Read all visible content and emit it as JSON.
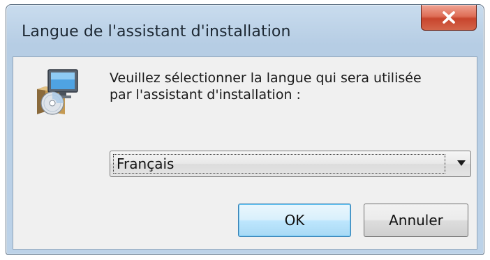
{
  "window": {
    "title": "Langue de l'assistant d'installation"
  },
  "titlebar": {
    "close_icon": "close-x-icon"
  },
  "content": {
    "icon": "setup-computer-disc-icon",
    "message_line1": "Veuillez sélectionner la langue qui sera utilisée",
    "message_line2": "par l'assistant d'installation :"
  },
  "language_select": {
    "selected": "Français",
    "arrow_icon": "chevron-down-icon"
  },
  "buttons": {
    "ok_label": "OK",
    "cancel_label": "Annuler"
  },
  "colors": {
    "close_button": "#d3654a",
    "default_button_border": "#3c7fb1"
  }
}
